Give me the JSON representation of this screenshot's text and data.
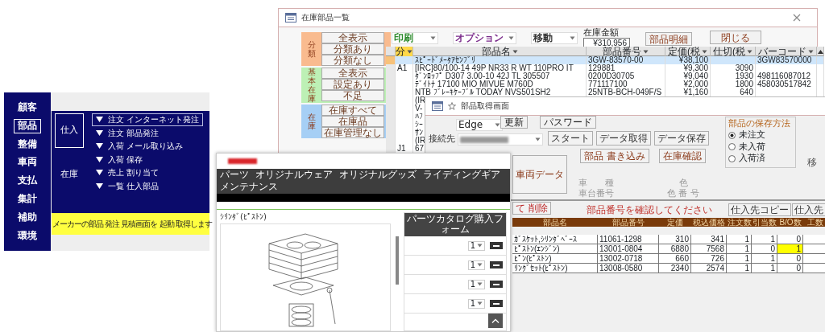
{
  "menu_window": {
    "sidebar": [
      {
        "label": "顧客",
        "selected": false
      },
      {
        "label": "部品",
        "selected": true
      },
      {
        "label": "整備",
        "selected": false
      },
      {
        "label": "車両",
        "selected": false
      },
      {
        "label": "支払",
        "selected": false
      },
      {
        "label": "集計",
        "selected": false
      },
      {
        "label": "補助",
        "selected": false
      },
      {
        "label": "環境",
        "selected": false
      }
    ],
    "categories": [
      {
        "label": "仕入",
        "selected": true
      },
      {
        "label": "在庫",
        "selected": false
      }
    ],
    "items": [
      {
        "label": "注文 インターネット発注",
        "selected": true
      },
      {
        "label": "注文 部品発注",
        "selected": false
      },
      {
        "label": "入荷 メール取り込み",
        "selected": false
      },
      {
        "label": "入荷 保存",
        "selected": false
      },
      {
        "label": "売上 割り当て",
        "selected": false
      },
      {
        "label": "一覧 仕入部品",
        "selected": false
      }
    ],
    "status_message": "メーカーの部品 発注 見積画面を 起動 取得します"
  },
  "stock_window": {
    "title": "在庫部品一覧",
    "filter_groups": [
      {
        "label": "分類",
        "color": "#f9bb8f",
        "buttons": [
          "全表示",
          "分類あり",
          "分類なし"
        ]
      },
      {
        "label": "基本在庫",
        "color": "#bdf0b5",
        "buttons": [
          "全表示",
          "設定あり",
          "不足"
        ]
      },
      {
        "label": "在庫",
        "color": "#a6cff5",
        "buttons": [
          "在庫すべて",
          "在庫品",
          "在庫管理なし"
        ]
      }
    ],
    "toolbar": {
      "dropdowns": [
        {
          "label": "印刷",
          "color": "#2e8b2e"
        },
        {
          "label": "オプション",
          "color": "#7a2a8a"
        },
        {
          "label": "移動",
          "color": "#333333"
        }
      ],
      "stock_value_label": "在庫金額",
      "stock_value": "¥310,956",
      "buttons": [
        "部品明細",
        "閉じる"
      ]
    },
    "table": {
      "columns": [
        "分",
        "部品名",
        "部品番号",
        "定価(税",
        "仕切(税",
        "バーコード"
      ],
      "rows": [
        {
          "selected": true,
          "name": "ｽﾋﾟｰﾄﾞﾒｰﾀｱｾﾝﾌﾞﾘ",
          "number": "3GW-83570-00",
          "list_price": "¥38,100",
          "barcode": "3GW83570000"
        },
        {
          "selected": false,
          "category": "A1",
          "name": "[IRC]80/100-14 49P NR33 R WT 110PRO IT",
          "number": "129881",
          "list_price": "¥9,300",
          "cost": "3090"
        },
        {
          "selected": false,
          "name": "ﾀﾞﾝﾛｯﾌﾟ D307 3.00-10 42J TL 305507",
          "number": "0200D30705",
          "list_price": "¥9,040",
          "cost": "1930",
          "barcode": "498116087012"
        },
        {
          "selected": false,
          "name": "ﾃﾞｲﾄﾅ 17100 MIO MIVUE M760D",
          "number": "771117100",
          "list_price": "¥2,000",
          "cost": "1800",
          "barcode": "458030517842"
        },
        {
          "selected": false,
          "name": "NTB ﾌﾞﾚｰｷｹｰﾌﾞﾙ TODAY NVS501SH2",
          "number": "25NTB-BCH-049F/S",
          "list_price": "¥1,160",
          "cost": "640"
        },
        {
          "selected": false,
          "name": "(IR"
        },
        {
          "selected": false,
          "name": "V-"
        },
        {
          "selected": false,
          "name": "ﾊﾌ"
        },
        {
          "selected": false,
          "name": "ｼｰ"
        },
        {
          "selected": false,
          "name": "ｻﾝ"
        },
        {
          "selected": false,
          "name": "(IR"
        },
        {
          "selected": false,
          "category": "J1",
          "name": "67"
        }
      ]
    }
  },
  "parts_window": {
    "title": "部品取得画面",
    "browser": "Edge",
    "top_buttons": [
      "更新",
      "パスワード"
    ],
    "connection_label": "接続先",
    "action_buttons": [
      "スタート",
      "データ取得",
      "データ保存"
    ],
    "secondary_buttons": [
      "部品 書き込み",
      "在庫確認"
    ],
    "save_method": {
      "label": "部品の保存方法",
      "options": [
        {
          "label": "未注文",
          "selected": true
        },
        {
          "label": "未入荷",
          "selected": false
        },
        {
          "label": "入荷済",
          "selected": false
        }
      ]
    },
    "cut_label": "移",
    "vehicle_button": "車両データ",
    "vehicle_labels": [
      "車　　種",
      "車台番号"
    ],
    "color_labels": [
      "色",
      "色 番 号"
    ],
    "delete_button": "て 削除",
    "message": "部品番号を確認してください",
    "copy_buttons": [
      "仕入先コピー",
      "仕入先"
    ],
    "table": {
      "columns": [
        "部品名",
        "部品番号",
        "定価",
        "税込価格",
        "注文数",
        "引当数",
        "B/O数",
        "工数"
      ],
      "rows": [
        {
          "name": "ｶﾞｽｹｯﾄ,ｼﾘﾝﾀﾞﾍﾞｰｽ",
          "number": "11061-1298",
          "list_price": "310",
          "tax_price": "341",
          "ordered": "1",
          "allocated": "1",
          "backorder": "0",
          "backorder_flag": false
        },
        {
          "name": "ﾋﾟｽﾄﾝ(ｴﾝｼﾞﾝ)",
          "number": "13001-0804",
          "list_price": "6880",
          "tax_price": "7568",
          "ordered": "1",
          "allocated": "0",
          "backorder": "1",
          "backorder_flag": true
        },
        {
          "name": "ﾋﾟﾝ(ﾋﾟｽﾄﾝ)",
          "number": "13002-0718",
          "list_price": "660",
          "tax_price": "726",
          "ordered": "1",
          "allocated": "1",
          "backorder": "0",
          "backorder_flag": false
        },
        {
          "name": "ﾘﾝｸﾞｾｯﾄ(ﾋﾟｽﾄﾝ)",
          "number": "13008-0580",
          "list_price": "2340",
          "tax_price": "2574",
          "ordered": "1",
          "allocated": "1",
          "backorder": "0",
          "backorder_flag": false
        }
      ]
    }
  },
  "web_window": {
    "nav": [
      "パーツ",
      "オリジナルウェア",
      "オリジナルグッズ",
      "ライディングギア",
      "メンテナンス"
    ],
    "page_title": "ｼﾘﾝﾀﾞ(ﾋﾟｽﾄﾝ)",
    "form_title": "パーツカタログ購入フォーム",
    "form_rows": [
      {
        "quantity": "1"
      },
      {
        "quantity": "1"
      },
      {
        "quantity": "1"
      },
      {
        "quantity": "1"
      }
    ]
  }
}
